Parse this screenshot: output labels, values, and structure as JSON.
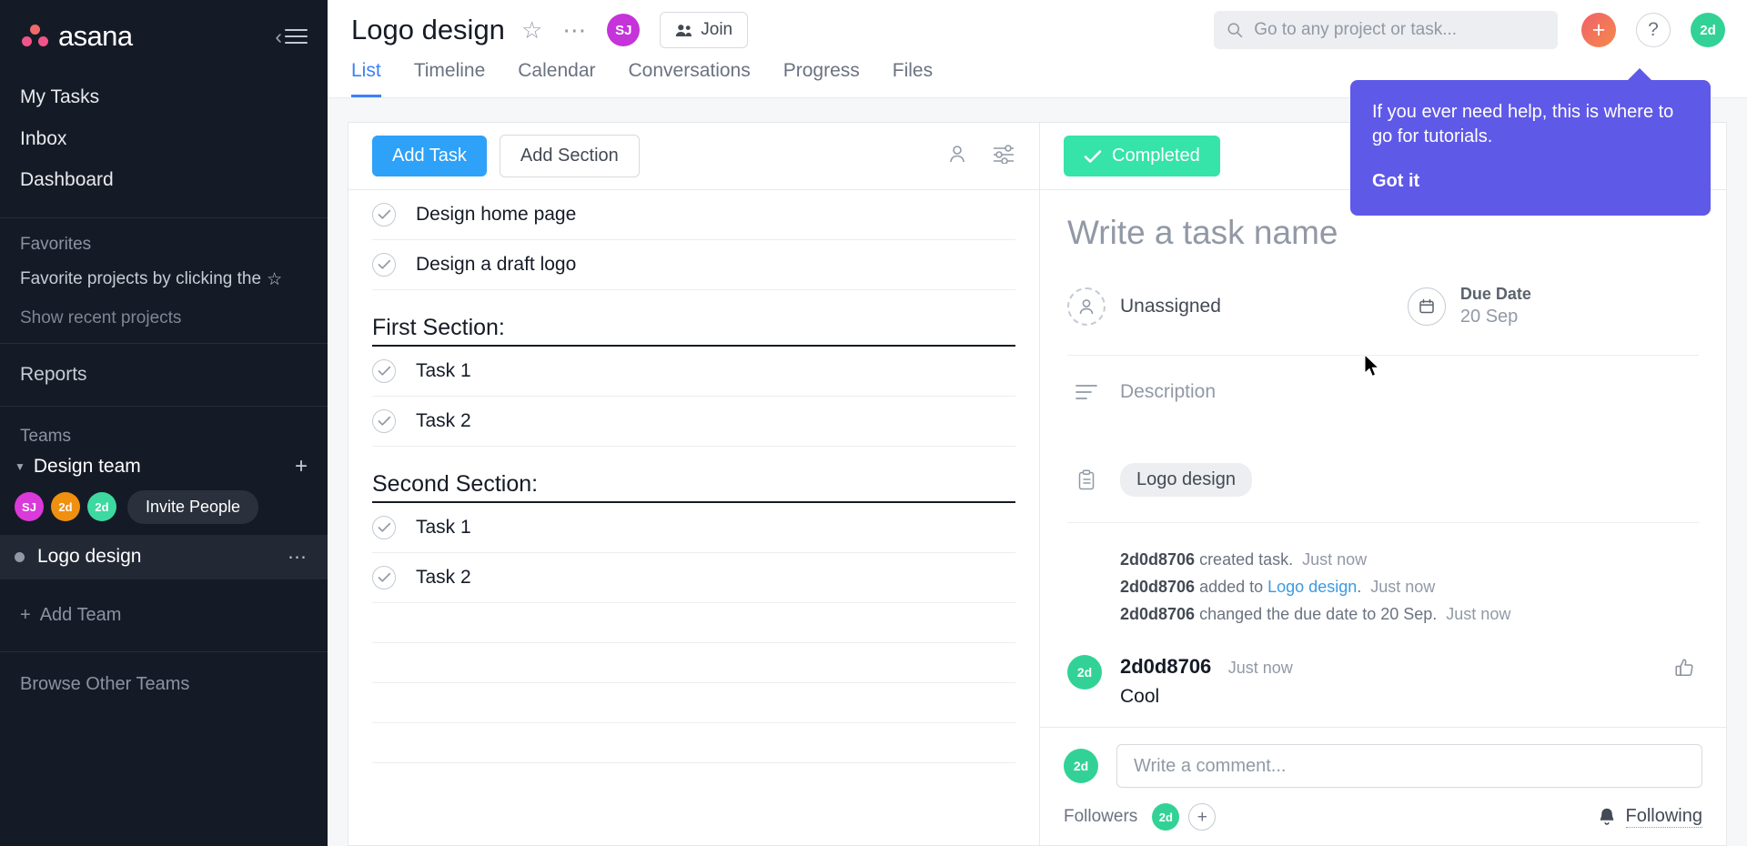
{
  "sidebar": {
    "brand": "asana",
    "nav": [
      {
        "label": "My Tasks"
      },
      {
        "label": "Inbox"
      },
      {
        "label": "Dashboard"
      }
    ],
    "favorites": {
      "heading": "Favorites",
      "hint": "Favorite projects by clicking the",
      "show_recent": "Show recent projects"
    },
    "reports": "Reports",
    "teams_heading": "Teams",
    "team": {
      "name": "Design team",
      "members": [
        {
          "initials": "SJ",
          "color": "#d93ad9"
        },
        {
          "initials": "2d",
          "color": "#f09010"
        },
        {
          "initials": "2d",
          "color": "#3dd9a0"
        }
      ],
      "invite_label": "Invite People"
    },
    "project": {
      "name": "Logo design"
    },
    "add_team": "Add Team",
    "browse_other_teams": "Browse Other Teams"
  },
  "header": {
    "project_title": "Logo design",
    "avatar": {
      "initials": "SJ",
      "color": "#c434d9"
    },
    "join_label": "Join",
    "tabs": [
      {
        "label": "List",
        "active": true
      },
      {
        "label": "Timeline",
        "active": false
      },
      {
        "label": "Calendar",
        "active": false
      },
      {
        "label": "Conversations",
        "active": false
      },
      {
        "label": "Progress",
        "active": false
      },
      {
        "label": "Files",
        "active": false
      }
    ],
    "search": {
      "placeholder": "Go to any project or task...",
      "value": ""
    },
    "help_label": "?",
    "plus_label": "+",
    "me_avatar": {
      "initials": "2d",
      "color": "#32d296"
    }
  },
  "tooltip": {
    "text": "If you ever need help, this is where to go for tutorials.",
    "cta": "Got it"
  },
  "list": {
    "add_task_label": "Add Task",
    "add_section_label": "Add Section",
    "rows": [
      {
        "kind": "task",
        "label": "Design home page"
      },
      {
        "kind": "task",
        "label": "Design a draft logo"
      },
      {
        "kind": "section",
        "label": "First Section:"
      },
      {
        "kind": "task",
        "label": "Task 1"
      },
      {
        "kind": "task",
        "label": "Task 2"
      },
      {
        "kind": "section",
        "label": "Second Section:"
      },
      {
        "kind": "task",
        "label": "Task 1"
      },
      {
        "kind": "task",
        "label": "Task 2"
      }
    ],
    "empty_rows": 4
  },
  "detail": {
    "completed_label": "Completed",
    "task_name_placeholder": "Write a task name",
    "task_name_value": "",
    "assignee_label": "Unassigned",
    "due_date_label": "Due Date",
    "due_date_value": "20 Sep",
    "description_label": "Description",
    "project_tag": "Logo design",
    "activity": [
      {
        "user": "2d0d8706",
        "text": "created task.",
        "link": "",
        "tail": "",
        "time": "Just now"
      },
      {
        "user": "2d0d8706",
        "text": "added to ",
        "link": "Logo design",
        "tail": ".",
        "time": "Just now"
      },
      {
        "user": "2d0d8706",
        "text": "changed the due date to 20 Sep.",
        "link": "",
        "tail": "",
        "time": "Just now"
      }
    ],
    "comments": [
      {
        "avatar": "2d",
        "author": "2d0d8706",
        "time": "Just now",
        "body": "Cool"
      }
    ],
    "comment_input_placeholder": "Write a comment...",
    "comment_input_value": "",
    "comment_avatar": "2d",
    "followers_label": "Followers",
    "followers": [
      {
        "initials": "2d",
        "color": "#32d296"
      }
    ],
    "following_label": "Following"
  },
  "colors": {
    "accent_blue": "#2ea1f8",
    "tab_active": "#3b82f6",
    "completed_green": "#36e3a8",
    "tooltip_purple": "#5f59e8",
    "sidebar_bg": "#151b26"
  }
}
